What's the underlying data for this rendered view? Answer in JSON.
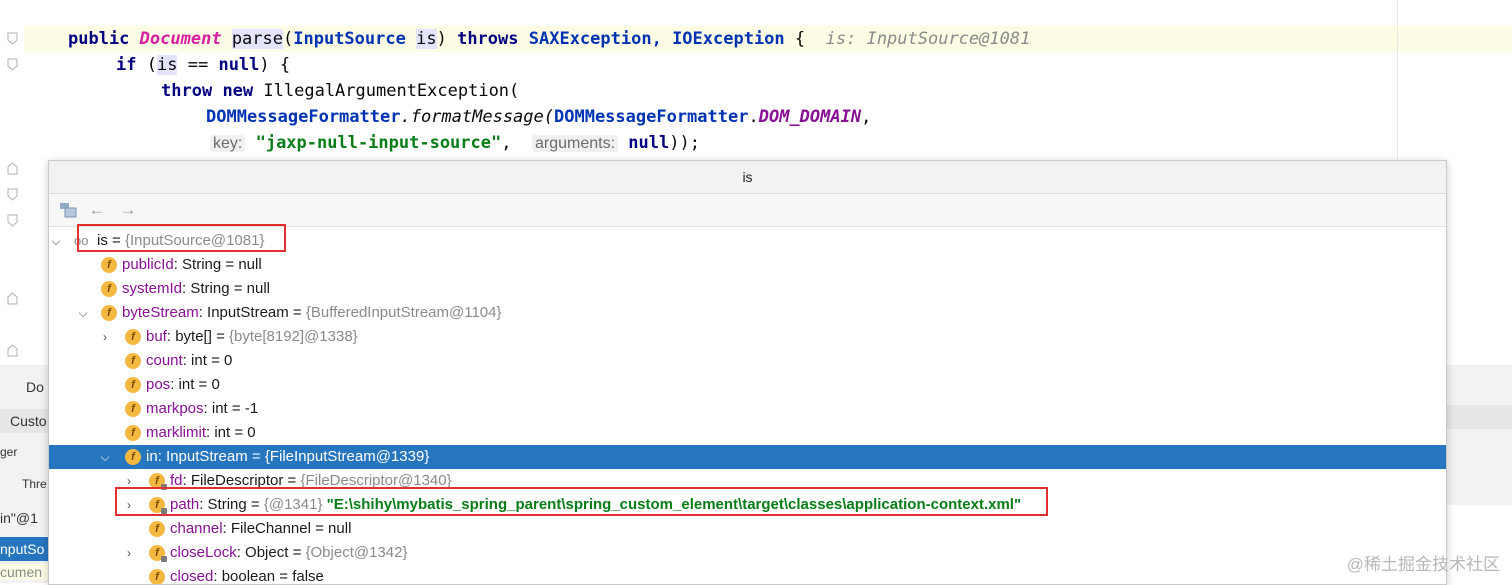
{
  "editor": {
    "line1": {
      "k_public": "public",
      "t_document": "Document",
      "m_parse": "parse",
      "p_open": "(",
      "t_inputsource": "InputSource",
      "v_is": "is",
      "p_close": ")",
      "k_throws": "throws",
      "t_sax": "SAXException,",
      "t_io": "IOException",
      "p_brace": "{",
      "hint": "is: InputSource@1081"
    },
    "line2": {
      "k_if": "if",
      "p_open": "(",
      "v_is": "is",
      "op": "==",
      "k_null": "null",
      "rest": ") {"
    },
    "line3": {
      "k_throw": "throw",
      "k_new": "new",
      "cls": "IllegalArgumentException("
    },
    "line4": {
      "t_fmt": "DOMMessageFormatter",
      "m_fmt": ".formatMessage(",
      "t_fmt2": "DOMMessageFormatter",
      "dot": ".",
      "s_domain": "DOM_DOMAIN",
      "comma": ","
    },
    "line5": {
      "h_key": "key:",
      "s_key": "\"jaxp-null-input-source\"",
      "comma": ",",
      "h_args": "arguments:",
      "k_null": "null",
      "rest": "));"
    }
  },
  "background": {
    "left_rows": [
      "Do",
      "Custo",
      "ger",
      "Thre",
      "in\"@1",
      "nputSo",
      "cumen"
    ]
  },
  "popup": {
    "title": "is",
    "toolbar": {
      "back_icon": "←",
      "forward_icon": "→"
    },
    "rows": [
      {
        "name": "is",
        "type": "",
        "value": "{InputSource@1081}",
        "extra": ""
      },
      {
        "name": "publicId",
        "type": ": String",
        "value": "null",
        "extra": ""
      },
      {
        "name": "systemId",
        "type": ": String",
        "value": "null",
        "extra": ""
      },
      {
        "name": "byteStream",
        "type": ": InputStream",
        "value": "{BufferedInputStream@1104}",
        "extra": ""
      },
      {
        "name": "buf",
        "type": ": byte[]",
        "value": "{byte[8192]@1338}",
        "extra": ""
      },
      {
        "name": "count",
        "type": ": int",
        "value": "0",
        "extra": ""
      },
      {
        "name": "pos",
        "type": ": int",
        "value": "0",
        "extra": ""
      },
      {
        "name": "markpos",
        "type": ": int",
        "value": "-1",
        "extra": ""
      },
      {
        "name": "marklimit",
        "type": ": int",
        "value": "0",
        "extra": ""
      },
      {
        "name": "in",
        "type": ": InputStream",
        "value": "{FileInputStream@1339}",
        "extra": ""
      },
      {
        "name": "fd",
        "type": ": FileDescriptor",
        "value": "{FileDescriptor@1340}",
        "extra": ""
      },
      {
        "name": "path",
        "type": ": String",
        "value": "{@1341}",
        "extra": "\"E:\\shihy\\mybatis_spring_parent\\spring_custom_element\\target\\classes\\application-context.xml\""
      },
      {
        "name": "channel",
        "type": ": FileChannel",
        "value": "null",
        "extra": ""
      },
      {
        "name": "closeLock",
        "type": ": Object",
        "value": "{Object@1342}",
        "extra": ""
      },
      {
        "name": "closed",
        "type": ": boolean",
        "value": "false",
        "extra": ""
      }
    ],
    "eq": "=",
    "oo_glyph": "oo",
    "f_glyph": "f"
  },
  "watermark": "@稀土掘金技术社区",
  "colors": {
    "selection": "#2675bf",
    "highlight_box": "#e03030",
    "field_icon": "#f4b840"
  }
}
